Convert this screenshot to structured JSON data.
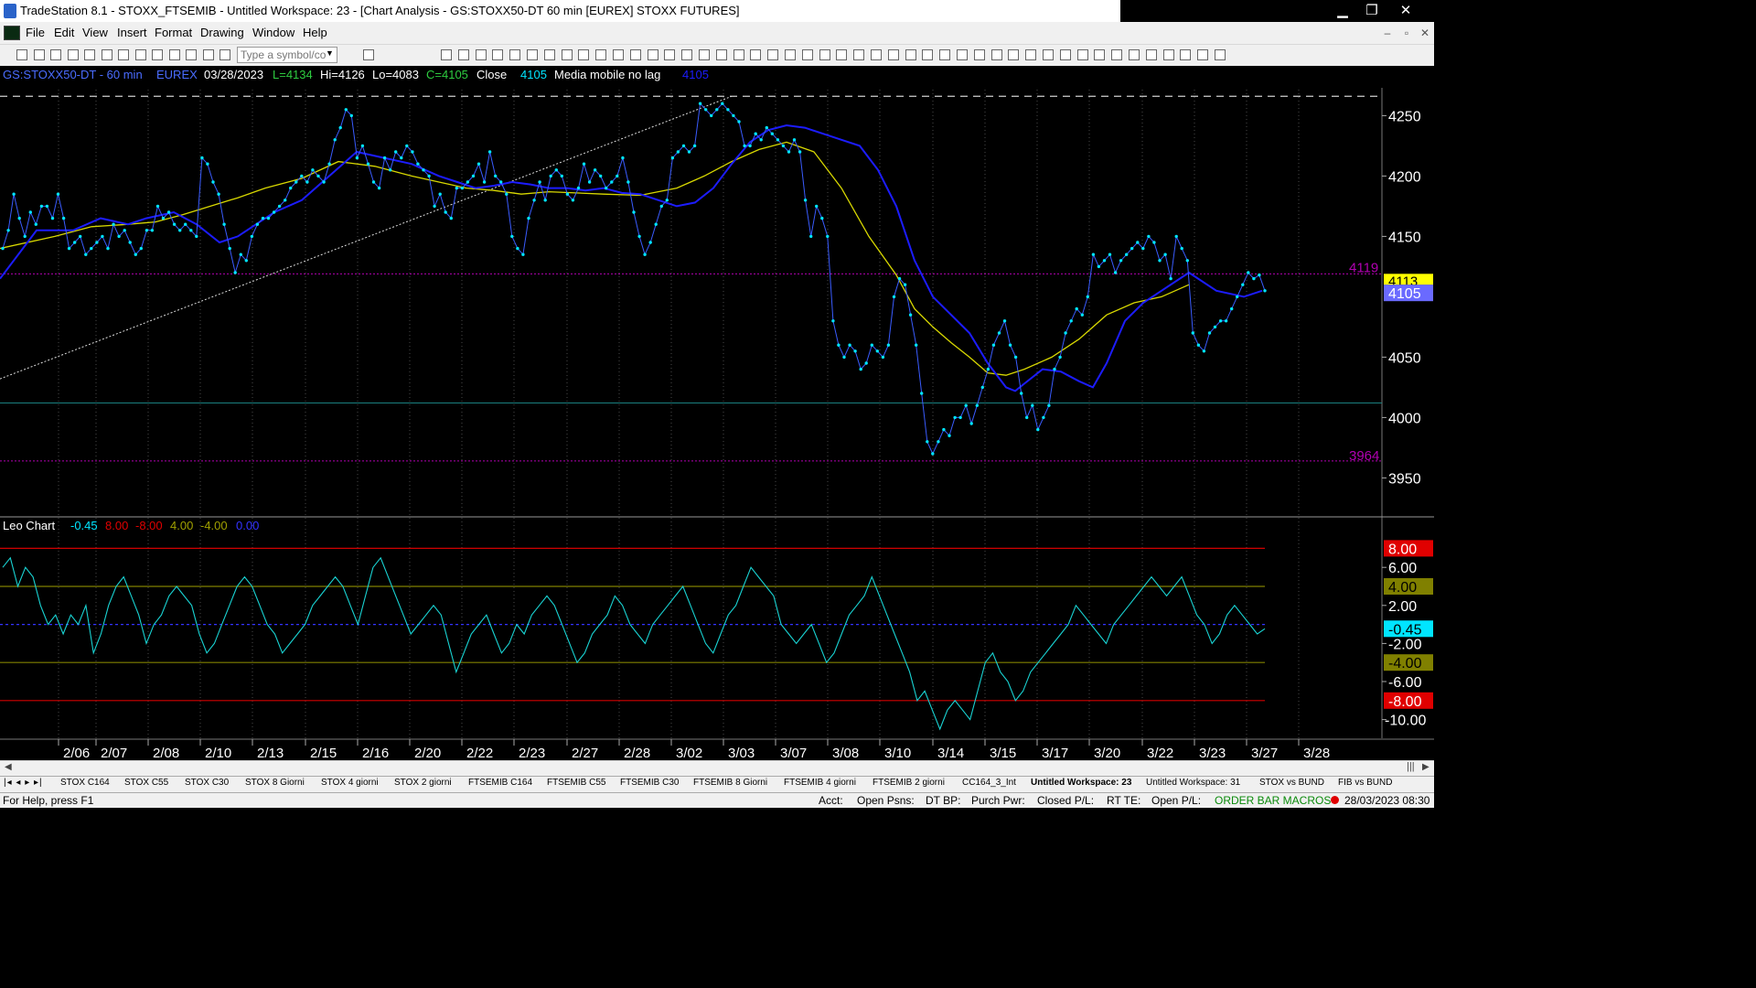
{
  "window": {
    "title": "TradeStation 8.1 - STOXX_FTSEMIB - Untitled Workspace: 23 - [Chart Analysis - GS:STOXX50-DT  60 min  [EUREX] STOXX FUTURES]",
    "minimize": "▁",
    "restore": "❐",
    "close": "✕"
  },
  "menu": {
    "items": [
      "File",
      "Edit",
      "View",
      "Insert",
      "Format",
      "Drawing",
      "Window",
      "Help"
    ],
    "mdi": [
      "–",
      "▫",
      "✕"
    ]
  },
  "toolbar": {
    "symbol_placeholder": "Type a symbol/co"
  },
  "header": {
    "symbol": "GS:STOXX50-DT - 60 min",
    "exchange": "EUREX",
    "date": "03/28/2023",
    "l": "L=4134",
    "hi": "Hi=4126",
    "lo": "Lo=4083",
    "c": "C=4105",
    "close_label": "Close",
    "close_value": "4105",
    "indicator": "Media mobile no lag",
    "indicator_value": "4105"
  },
  "price_axis": {
    "ticks": [
      "4250",
      "4200",
      "4150",
      "4100",
      "4050",
      "4000",
      "3950"
    ],
    "level_high": "4119",
    "level_low": "3964",
    "tag_ma": "4113",
    "tag_last": "4105"
  },
  "osc_header": {
    "name": "Leo Chart",
    "values": [
      "-0.45",
      "8.00",
      "-8.00",
      "4.00",
      "-4.00",
      "0.00"
    ]
  },
  "osc_axis": {
    "ticks": [
      "6.00",
      "2.00",
      "-2.00",
      "-6.00",
      "-10.00"
    ],
    "tags": [
      "8.00",
      "4.00",
      "-0.45",
      "-4.00",
      "-8.00"
    ]
  },
  "dates": [
    "2/06",
    "2/07",
    "2/08",
    "2/10",
    "2/13",
    "2/15",
    "2/16",
    "2/20",
    "2/22",
    "2/23",
    "2/27",
    "2/28",
    "3/02",
    "3/03",
    "3/07",
    "3/08",
    "3/10",
    "3/14",
    "3/15",
    "3/17",
    "3/20",
    "3/22",
    "3/23",
    "3/27",
    "3/28"
  ],
  "tabs": [
    "STOX C164",
    "STOX C55",
    "STOX  C30",
    "STOX  8 Giorni",
    "STOX 4 giorni",
    "STOX  2 giorni",
    "FTSEMIB C164",
    "FTSEMIB C55",
    "FTSEMIB C30",
    "FTSEMIB  8 Giorni",
    "FTSEMIB  4 giorni",
    "FTSEMIB  2 giorni",
    "CC164_3_Int",
    "Untitled Workspace:  23",
    "Untitled Workspace:  31",
    "STOX vs BUND",
    "FIB vs BUND"
  ],
  "status": {
    "help": "For Help, press F1",
    "acct": "Acct:",
    "open_psns": "Open Psns:",
    "dt_bp": "DT BP:",
    "purch_pwr": "Purch Pwr:",
    "closed_pl": "Closed P/L:",
    "rt_te": "RT TE:",
    "open_pl": "Open P/L:",
    "macros": "ORDER BAR  MACROS",
    "datetime": "28/03/2023 08:30"
  },
  "colors": {
    "price_dots": "#00e5ff",
    "ma_blue": "#1c1cff",
    "ma_yellow": "#d8d800",
    "oscillator": "#19d3d3",
    "level_magenta": "#b000b0",
    "level_red": "#d00000",
    "level_olive": "#808000",
    "support_teal": "#1a8080"
  },
  "chart_data": {
    "type": "line",
    "price_closes": [
      4140,
      4155,
      4185,
      4165,
      4150,
      4170,
      4160,
      4175,
      4175,
      4165,
      4185,
      4165,
      4140,
      4145,
      4150,
      4135,
      4140,
      4145,
      4150,
      4140,
      4160,
      4150,
      4155,
      4145,
      4135,
      4140,
      4155,
      4155,
      4175,
      4165,
      4170,
      4160,
      4155,
      4160,
      4155,
      4150,
      4215,
      4210,
      4195,
      4185,
      4160,
      4140,
      4120,
      4135,
      4130,
      4150,
      4160,
      4165,
      4165,
      4170,
      4175,
      4180,
      4190,
      4195,
      4200,
      4195,
      4205,
      4200,
      4195,
      4210,
      4230,
      4240,
      4255,
      4250,
      4215,
      4225,
      4210,
      4195,
      4190,
      4215,
      4205,
      4220,
      4215,
      4225,
      4220,
      4210,
      4205,
      4200,
      4175,
      4185,
      4170,
      4165,
      4190,
      4190,
      4195,
      4200,
      4210,
      4195,
      4220,
      4200,
      4195,
      4185,
      4150,
      4140,
      4135,
      4165,
      4180,
      4195,
      4180,
      4200,
      4205,
      4200,
      4185,
      4180,
      4190,
      4210,
      4195,
      4205,
      4200,
      4190,
      4195,
      4200,
      4215,
      4195,
      4170,
      4150,
      4135,
      4145,
      4160,
      4175,
      4180,
      4215,
      4220,
      4225,
      4220,
      4225,
      4260,
      4255,
      4250,
      4255,
      4260,
      4255,
      4250,
      4245,
      4225,
      4225,
      4235,
      4230,
      4240,
      4235,
      4230,
      4225,
      4220,
      4230,
      4220,
      4180,
      4150,
      4175,
      4165,
      4150,
      4080,
      4060,
      4050,
      4060,
      4055,
      4040,
      4045,
      4060,
      4055,
      4050,
      4060,
      4100,
      4115,
      4110,
      4085,
      4060,
      4020,
      3980,
      3970,
      3980,
      3990,
      3985,
      4000,
      4000,
      4010,
      3995,
      4010,
      4025,
      4040,
      4060,
      4070,
      4080,
      4060,
      4050,
      4020,
      4000,
      4010,
      3990,
      4000,
      4010,
      4040,
      4050,
      4070,
      4080,
      4090,
      4085,
      4100,
      4135,
      4125,
      4130,
      4135,
      4120,
      4130,
      4135,
      4140,
      4145,
      4140,
      4150,
      4145,
      4130,
      4135,
      4115,
      4150,
      4140,
      4130,
      4070,
      4060,
      4055,
      4070,
      4075,
      4080,
      4080,
      4090,
      4100,
      4110,
      4120,
      4115,
      4118,
      4105
    ],
    "moving_average_no_lag": {
      "name": "Media mobile no lag",
      "description": "blue line",
      "points": [
        [
          0,
          4115
        ],
        [
          40,
          4155
        ],
        [
          80,
          4155
        ],
        [
          110,
          4165
        ],
        [
          140,
          4160
        ],
        [
          160,
          4165
        ],
        [
          190,
          4170
        ],
        [
          215,
          4160
        ],
        [
          240,
          4145
        ],
        [
          260,
          4150
        ],
        [
          280,
          4160
        ],
        [
          300,
          4170
        ],
        [
          330,
          4180
        ],
        [
          360,
          4200
        ],
        [
          390,
          4220
        ],
        [
          420,
          4215
        ],
        [
          450,
          4210
        ],
        [
          480,
          4200
        ],
        [
          500,
          4195
        ],
        [
          520,
          4190
        ],
        [
          540,
          4192
        ],
        [
          560,
          4195
        ],
        [
          580,
          4193
        ],
        [
          600,
          4190
        ],
        [
          620,
          4190
        ],
        [
          640,
          4188
        ],
        [
          660,
          4190
        ],
        [
          680,
          4186
        ],
        [
          700,
          4185
        ],
        [
          720,
          4180
        ],
        [
          740,
          4175
        ],
        [
          760,
          4178
        ],
        [
          780,
          4190
        ],
        [
          800,
          4210
        ],
        [
          820,
          4228
        ],
        [
          840,
          4238
        ],
        [
          860,
          4242
        ],
        [
          880,
          4240
        ],
        [
          900,
          4235
        ],
        [
          920,
          4230
        ],
        [
          940,
          4225
        ],
        [
          960,
          4205
        ],
        [
          980,
          4175
        ],
        [
          1000,
          4130
        ],
        [
          1020,
          4100
        ],
        [
          1040,
          4085
        ],
        [
          1060,
          4070
        ],
        [
          1080,
          4045
        ],
        [
          1100,
          4025
        ],
        [
          1110,
          4022
        ],
        [
          1120,
          4028
        ],
        [
          1140,
          4040
        ],
        [
          1160,
          4038
        ],
        [
          1180,
          4030
        ],
        [
          1195,
          4025
        ],
        [
          1210,
          4045
        ],
        [
          1230,
          4080
        ],
        [
          1250,
          4095
        ],
        [
          1270,
          4105
        ],
        [
          1300,
          4120
        ],
        [
          1330,
          4105
        ],
        [
          1360,
          4100
        ],
        [
          1380,
          4105
        ]
      ]
    },
    "moving_average_yellow": {
      "points": [
        [
          0,
          4140
        ],
        [
          60,
          4150
        ],
        [
          100,
          4158
        ],
        [
          140,
          4160
        ],
        [
          170,
          4162
        ],
        [
          200,
          4168
        ],
        [
          230,
          4175
        ],
        [
          260,
          4182
        ],
        [
          290,
          4190
        ],
        [
          330,
          4198
        ],
        [
          370,
          4212
        ],
        [
          410,
          4208
        ],
        [
          450,
          4200
        ],
        [
          480,
          4195
        ],
        [
          510,
          4190
        ],
        [
          540,
          4188
        ],
        [
          570,
          4185
        ],
        [
          600,
          4187
        ],
        [
          630,
          4186
        ],
        [
          660,
          4185
        ],
        [
          700,
          4184
        ],
        [
          740,
          4190
        ],
        [
          770,
          4200
        ],
        [
          800,
          4212
        ],
        [
          830,
          4222
        ],
        [
          860,
          4228
        ],
        [
          890,
          4220
        ],
        [
          920,
          4190
        ],
        [
          950,
          4150
        ],
        [
          980,
          4118
        ],
        [
          1000,
          4090
        ],
        [
          1020,
          4075
        ],
        [
          1040,
          4062
        ],
        [
          1060,
          4050
        ],
        [
          1080,
          4037
        ],
        [
          1100,
          4035
        ],
        [
          1120,
          4040
        ],
        [
          1150,
          4050
        ],
        [
          1180,
          4065
        ],
        [
          1210,
          4085
        ],
        [
          1240,
          4095
        ],
        [
          1270,
          4100
        ],
        [
          1300,
          4110
        ]
      ]
    },
    "oscillator": {
      "name": "Leo Chart",
      "values": [
        6,
        7,
        4,
        6,
        5,
        2,
        0,
        1,
        -1,
        1,
        0,
        2,
        -3,
        -1,
        2,
        4,
        5,
        3,
        1,
        -2,
        0,
        1,
        3,
        4,
        3,
        2,
        -1,
        -3,
        -2,
        0,
        2,
        4,
        5,
        4,
        2,
        0,
        -1,
        -3,
        -2,
        -1,
        0,
        2,
        3,
        4,
        5,
        4,
        2,
        0,
        3,
        6,
        7,
        5,
        3,
        1,
        -1,
        0,
        1,
        2,
        1,
        -2,
        -5,
        -3,
        -1,
        0,
        1,
        -1,
        -3,
        -2,
        0,
        -1,
        1,
        2,
        3,
        2,
        0,
        -2,
        -4,
        -3,
        -1,
        0,
        1,
        3,
        2,
        0,
        -1,
        -2,
        0,
        1,
        2,
        3,
        4,
        2,
        0,
        -2,
        -3,
        -1,
        1,
        2,
        4,
        6,
        5,
        4,
        3,
        0,
        -1,
        -2,
        -1,
        0,
        -2,
        -4,
        -3,
        -1,
        1,
        2,
        3,
        5,
        3,
        1,
        -1,
        -3,
        -5,
        -8,
        -7,
        -9,
        -11,
        -9,
        -8,
        -9,
        -10,
        -7,
        -4,
        -3,
        -5,
        -6,
        -8,
        -7,
        -5,
        -4,
        -3,
        -2,
        -1,
        0,
        2,
        1,
        0,
        -1,
        -2,
        0,
        1,
        2,
        3,
        4,
        5,
        4,
        3,
        4,
        5,
        3,
        1,
        0,
        -2,
        -1,
        1,
        2,
        1,
        0,
        -1,
        -0.45
      ]
    },
    "oscillator_levels": [
      8,
      4,
      0,
      -4,
      -8
    ],
    "price_levels": {
      "high": 4119,
      "low": 3964,
      "support": 4012,
      "resistance_dashed": 4266
    },
    "x_dates": [
      "2/06",
      "2/07",
      "2/08",
      "2/10",
      "2/13",
      "2/15",
      "2/16",
      "2/20",
      "2/22",
      "2/23",
      "2/27",
      "2/28",
      "3/02",
      "3/03",
      "3/07",
      "3/08",
      "3/10",
      "3/14",
      "3/15",
      "3/17",
      "3/20",
      "3/22",
      "3/23",
      "3/27",
      "3/28"
    ],
    "ylim": [
      3930,
      4270
    ],
    "osc_ylim": [
      -12,
      9
    ]
  }
}
